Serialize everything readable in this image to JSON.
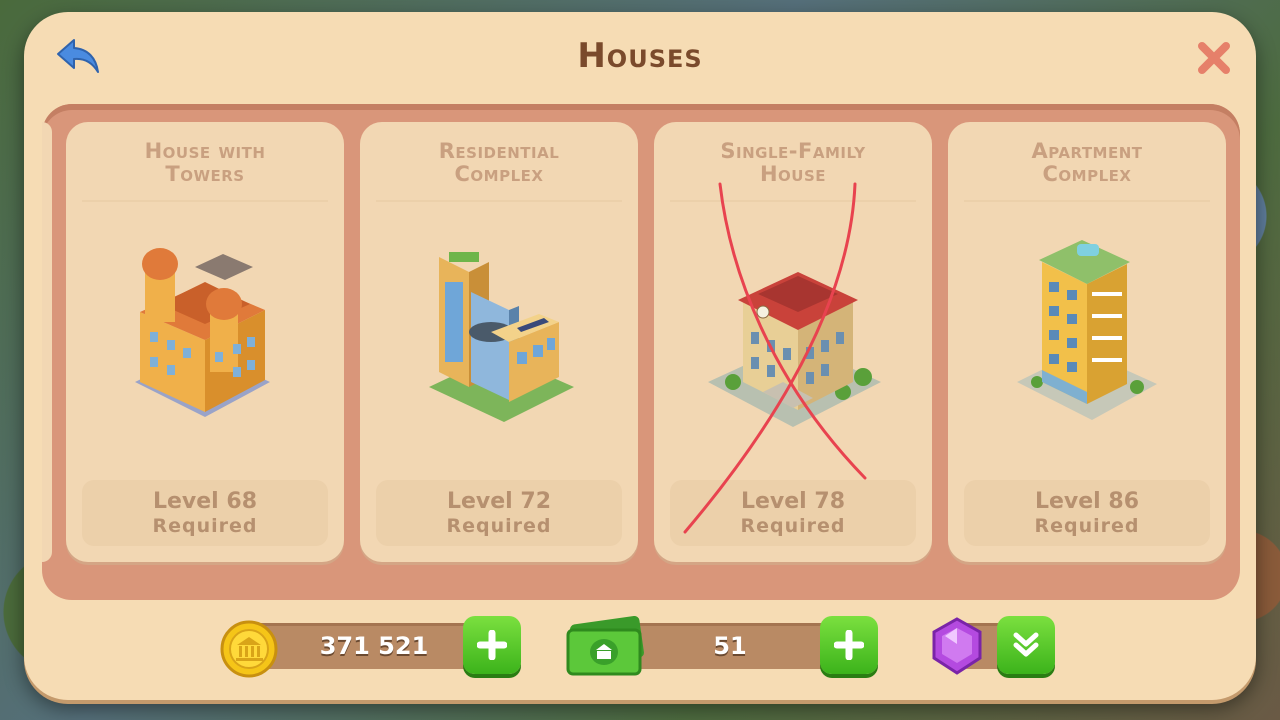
{
  "window": {
    "title": "Houses"
  },
  "icons": {
    "back": "back-arrow-icon",
    "close": "close-icon",
    "coin": "coin-icon",
    "cash": "banknote-icon",
    "gem": "gem-icon",
    "plus": "plus-icon",
    "expand": "chevron-double-down-icon"
  },
  "cards": [
    {
      "name_line1": "House with",
      "name_line2": "Towers",
      "level": "Level 68",
      "required": "Required"
    },
    {
      "name_line1": "Residential",
      "name_line2": "Complex",
      "level": "Level 72",
      "required": "Required"
    },
    {
      "name_line1": "Single-Family",
      "name_line2": "House",
      "level": "Level 78",
      "required": "Required"
    },
    {
      "name_line1": "Apartment",
      "name_line2": "Complex",
      "level": "Level 86",
      "required": "Required"
    }
  ],
  "currency": {
    "coins": "371 521",
    "cash": "51"
  },
  "colors": {
    "panel": "#f6dcb4",
    "inner": "#d9967a",
    "title": "#7a4a2c",
    "accent_green": "#3cb31b",
    "cross_mark": "#e8434f"
  }
}
